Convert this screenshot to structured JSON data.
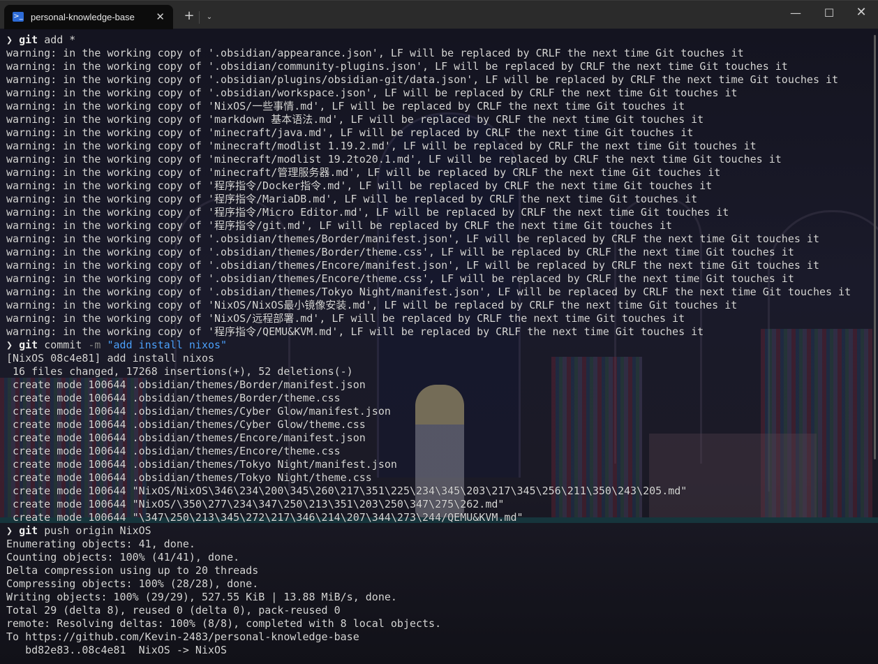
{
  "window": {
    "tab_icon": "powershell-icon",
    "tab_title": "personal-knowledge-base",
    "close_tab_glyph": "✕",
    "new_tab_glyph": "+",
    "dropdown_glyph": "⌄",
    "minimize_glyph": "—",
    "maximize_glyph": "☐",
    "close_glyph": "✕"
  },
  "colors": {
    "titlebar": "#2b2b2b",
    "tab_active": "#0c0c0c",
    "text": "#d7d7d7",
    "string": "#4fa3ff",
    "flag": "#8a8a8a"
  },
  "terminal": {
    "prompt_glyph": "❯",
    "lines": [
      {
        "type": "prompt",
        "cmd": "git",
        "args": [
          {
            "k": "arg",
            "t": "add *"
          }
        ]
      },
      {
        "t": "warning: in the working copy of '.obsidian/appearance.json', LF will be replaced by CRLF the next time Git touches it"
      },
      {
        "t": "warning: in the working copy of '.obsidian/community-plugins.json', LF will be replaced by CRLF the next time Git touches it"
      },
      {
        "t": "warning: in the working copy of '.obsidian/plugins/obsidian-git/data.json', LF will be replaced by CRLF the next time Git touches it"
      },
      {
        "t": "warning: in the working copy of '.obsidian/workspace.json', LF will be replaced by CRLF the next time Git touches it"
      },
      {
        "t": "warning: in the working copy of 'NixOS/一些事情.md', LF will be replaced by CRLF the next time Git touches it"
      },
      {
        "t": "warning: in the working copy of 'markdown 基本语法.md', LF will be replaced by CRLF the next time Git touches it"
      },
      {
        "t": "warning: in the working copy of 'minecraft/java.md', LF will be replaced by CRLF the next time Git touches it"
      },
      {
        "t": "warning: in the working copy of 'minecraft/modlist 1.19.2.md', LF will be replaced by CRLF the next time Git touches it"
      },
      {
        "t": "warning: in the working copy of 'minecraft/modlist 19.2to20.1.md', LF will be replaced by CRLF the next time Git touches it"
      },
      {
        "t": "warning: in the working copy of 'minecraft/管理服务器.md', LF will be replaced by CRLF the next time Git touches it"
      },
      {
        "t": "warning: in the working copy of '程序指令/Docker指令.md', LF will be replaced by CRLF the next time Git touches it"
      },
      {
        "t": "warning: in the working copy of '程序指令/MariaDB.md', LF will be replaced by CRLF the next time Git touches it"
      },
      {
        "t": "warning: in the working copy of '程序指令/Micro Editor.md', LF will be replaced by CRLF the next time Git touches it"
      },
      {
        "t": "warning: in the working copy of '程序指令/git.md', LF will be replaced by CRLF the next time Git touches it"
      },
      {
        "t": "warning: in the working copy of '.obsidian/themes/Border/manifest.json', LF will be replaced by CRLF the next time Git touches it"
      },
      {
        "t": "warning: in the working copy of '.obsidian/themes/Border/theme.css', LF will be replaced by CRLF the next time Git touches it"
      },
      {
        "t": "warning: in the working copy of '.obsidian/themes/Encore/manifest.json', LF will be replaced by CRLF the next time Git touches it"
      },
      {
        "t": "warning: in the working copy of '.obsidian/themes/Encore/theme.css', LF will be replaced by CRLF the next time Git touches it"
      },
      {
        "t": "warning: in the working copy of '.obsidian/themes/Tokyo Night/manifest.json', LF will be replaced by CRLF the next time Git touches it"
      },
      {
        "t": "warning: in the working copy of 'NixOS/NixOS最小镜像安装.md', LF will be replaced by CRLF the next time Git touches it"
      },
      {
        "t": "warning: in the working copy of 'NixOS/远程部署.md', LF will be replaced by CRLF the next time Git touches it"
      },
      {
        "t": "warning: in the working copy of '程序指令/QEMU&KVM.md', LF will be replaced by CRLF the next time Git touches it"
      },
      {
        "type": "prompt",
        "cmd": "git",
        "args": [
          {
            "k": "arg",
            "t": "commit "
          },
          {
            "k": "flag",
            "t": "-m "
          },
          {
            "k": "str",
            "t": "\"add install nixos\""
          }
        ]
      },
      {
        "t": "[NixOS 08c4e81] add install nixos"
      },
      {
        "t": " 16 files changed, 17268 insertions(+), 52 deletions(-)"
      },
      {
        "t": " create mode 100644 .obsidian/themes/Border/manifest.json"
      },
      {
        "t": " create mode 100644 .obsidian/themes/Border/theme.css"
      },
      {
        "t": " create mode 100644 .obsidian/themes/Cyber Glow/manifest.json"
      },
      {
        "t": " create mode 100644 .obsidian/themes/Cyber Glow/theme.css"
      },
      {
        "t": " create mode 100644 .obsidian/themes/Encore/manifest.json"
      },
      {
        "t": " create mode 100644 .obsidian/themes/Encore/theme.css"
      },
      {
        "t": " create mode 100644 .obsidian/themes/Tokyo Night/manifest.json"
      },
      {
        "t": " create mode 100644 .obsidian/themes/Tokyo Night/theme.css"
      },
      {
        "t": " create mode 100644 \"NixOS/NixOS\\346\\234\\200\\345\\260\\217\\351\\225\\234\\345\\203\\217\\345\\256\\211\\350\\243\\205.md\""
      },
      {
        "t": " create mode 100644 \"NixOS/\\350\\277\\234\\347\\250\\213\\351\\203\\250\\347\\275\\262.md\""
      },
      {
        "t": " create mode 100644 \"\\347\\250\\213\\345\\272\\217\\346\\214\\207\\344\\273\\244/QEMU&KVM.md\""
      },
      {
        "type": "prompt",
        "cmd": "git",
        "args": [
          {
            "k": "arg",
            "t": "push origin NixOS"
          }
        ]
      },
      {
        "t": "Enumerating objects: 41, done."
      },
      {
        "t": "Counting objects: 100% (41/41), done."
      },
      {
        "t": "Delta compression using up to 20 threads"
      },
      {
        "t": "Compressing objects: 100% (28/28), done."
      },
      {
        "t": "Writing objects: 100% (29/29), 527.55 KiB | 13.88 MiB/s, done."
      },
      {
        "t": "Total 29 (delta 8), reused 0 (delta 0), pack-reused 0"
      },
      {
        "t": "remote: Resolving deltas: 100% (8/8), completed with 8 local objects."
      },
      {
        "t": "To https://github.com/Kevin-2483/personal-knowledge-base"
      },
      {
        "t": "   bd82e83..08c4e81  NixOS -> NixOS"
      }
    ]
  }
}
